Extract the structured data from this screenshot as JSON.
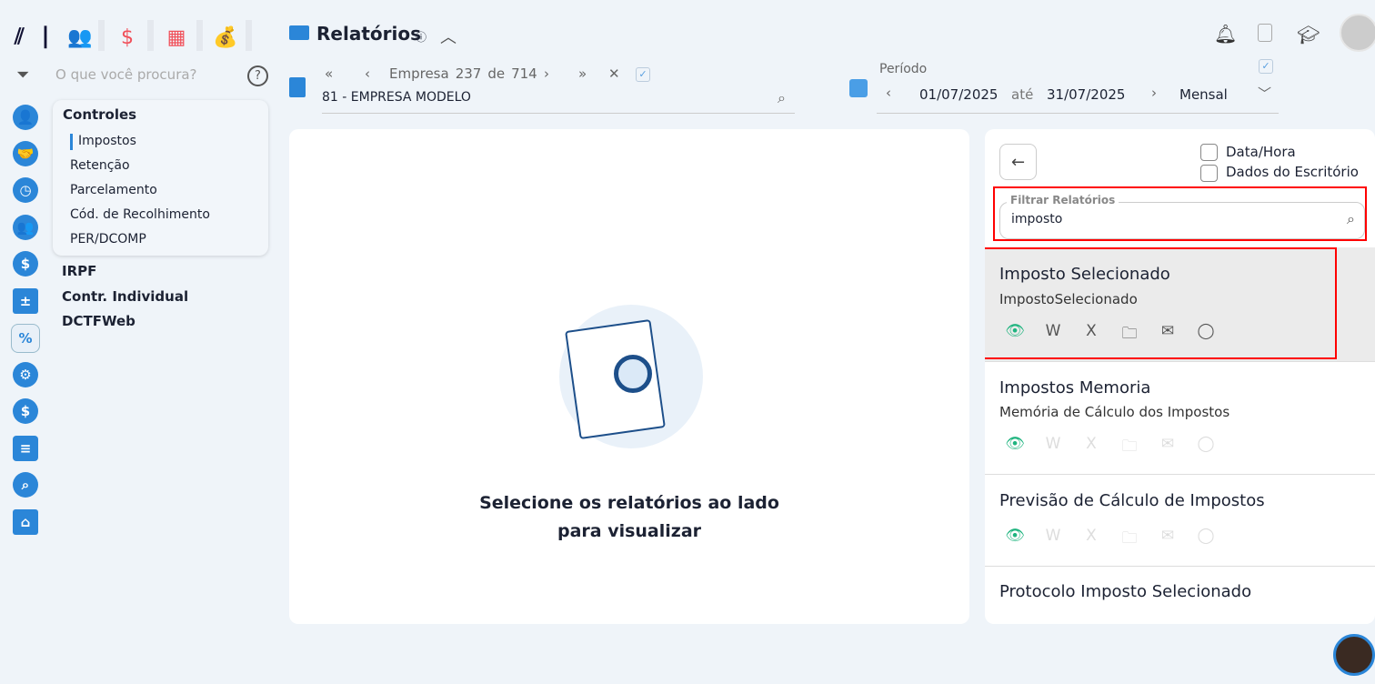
{
  "header": {
    "title": "Relatórios",
    "search_placeholder": "O que você procura?"
  },
  "menu": {
    "title": "Controles",
    "items": [
      "Impostos",
      "Retenção",
      "Parcelamento",
      "Cód. de Recolhimento",
      "PER/DCOMP"
    ],
    "sections": [
      "IRPF",
      "Contr. Individual",
      "DCTFWeb"
    ]
  },
  "empresa": {
    "label": "Empresa",
    "current": "237",
    "of": "de",
    "total": "714",
    "selected": "81 - EMPRESA MODELO"
  },
  "periodo": {
    "label": "Período",
    "start": "01/07/2025",
    "until": "até",
    "end": "31/07/2025",
    "type": "Mensal"
  },
  "empty": {
    "line1": "Selecione os relatórios ao lado",
    "line2": "para visualizar"
  },
  "options": {
    "datahora": "Data/Hora",
    "escritorio": "Dados do Escritório"
  },
  "filter": {
    "label": "Filtrar Relatórios",
    "value": "imposto"
  },
  "reports": [
    {
      "title": "Imposto Selecionado",
      "subtitle": "ImpostoSelecionado"
    },
    {
      "title": "Impostos Memoria",
      "subtitle": "Memória de Cálculo dos Impostos"
    },
    {
      "title": "Previsão de Cálculo de Impostos",
      "subtitle": ""
    },
    {
      "title": "Protocolo Imposto Selecionado",
      "subtitle": ""
    }
  ],
  "colors": {
    "accent": "#2b86d8",
    "highlight": "#ff0000",
    "eye": "#1fb47f"
  }
}
